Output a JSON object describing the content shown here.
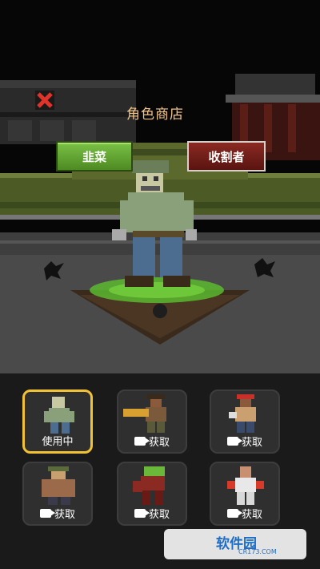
{
  "header": {
    "title": "角色商店",
    "close_icon": "close-icon"
  },
  "tabs": [
    {
      "label": "韭菜",
      "active": true
    },
    {
      "label": "收割者",
      "active": false
    }
  ],
  "characters": [
    {
      "label": "使用中",
      "state": "in-use",
      "icon": "zombie-character"
    },
    {
      "label": "获取",
      "state": "locked",
      "icon": "gunner-character"
    },
    {
      "label": "获取",
      "state": "locked",
      "icon": "cap-brawler-character"
    },
    {
      "label": "获取",
      "state": "locked",
      "icon": "fat-man-character"
    },
    {
      "label": "获取",
      "state": "locked",
      "icon": "mutant-character"
    },
    {
      "label": "获取",
      "state": "locked",
      "icon": "boxer-character"
    }
  ],
  "watermark": {
    "text": "软件园",
    "sub": "CR173.COM"
  },
  "colors": {
    "title": "#f1c48a",
    "active_tab": "#6db23a",
    "reaper_tab": "#7a1f18",
    "selected_slot": "#f3c233"
  }
}
